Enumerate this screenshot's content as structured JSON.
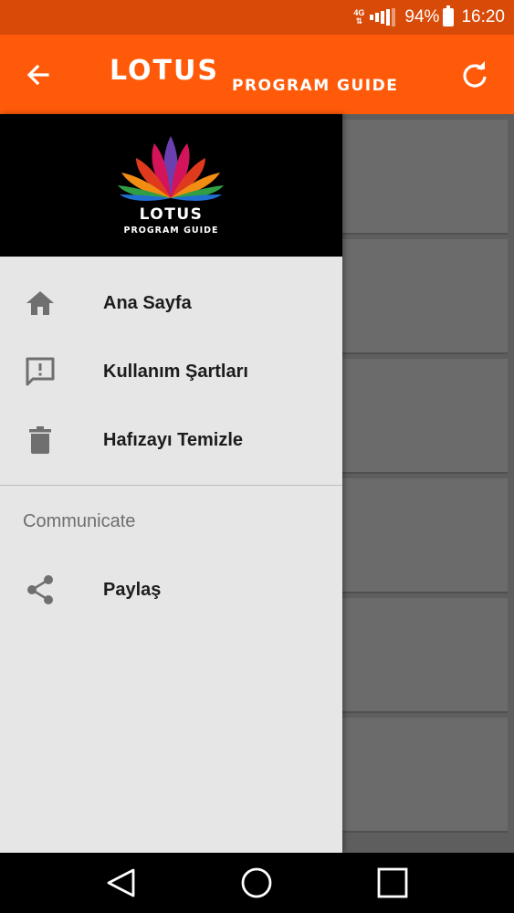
{
  "status_bar": {
    "network": "4G",
    "battery": "94%",
    "time": "16:20"
  },
  "app_bar": {
    "title_main": "LOTUS",
    "title_sub": "PROGRAM GUIDE",
    "back_icon": "arrow-back-icon",
    "refresh_icon": "refresh-icon"
  },
  "drawer": {
    "header": {
      "logo_title": "LOTUS",
      "logo_sub": "PROGRAM GUIDE"
    },
    "items": [
      {
        "label": "Ana Sayfa",
        "icon": "home-icon"
      },
      {
        "label": "Kullanım Şartları",
        "icon": "feedback-icon"
      },
      {
        "label": "Hafızayı Temizle",
        "icon": "trash-icon"
      }
    ],
    "section_title": "Communicate",
    "section_items": [
      {
        "label": "Paylaş",
        "icon": "share-icon"
      }
    ]
  },
  "nav_bar": {
    "back": "nav-back-icon",
    "home": "nav-home-icon",
    "recents": "nav-recents-icon"
  },
  "colors": {
    "status_bar": "#d84a08",
    "app_bar": "#ff5a0a",
    "drawer_bg": "#e6e6e6",
    "icon_gray": "#6f6f6f"
  }
}
